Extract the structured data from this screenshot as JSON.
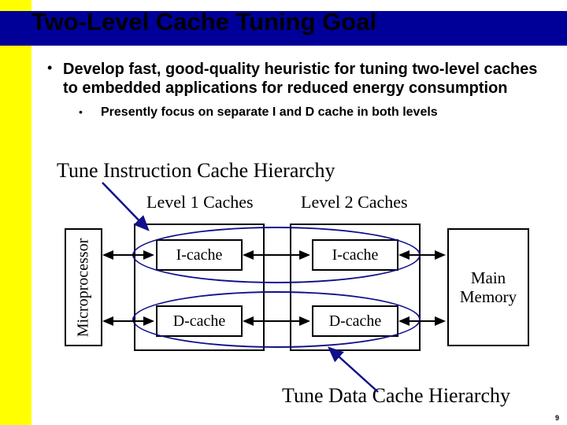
{
  "title": "Two-Level Cache Tuning Goal",
  "bullets": {
    "main": "Develop fast, good-quality heuristic for tuning two-level caches to embedded applications for reduced energy consumption",
    "sub": "Presently focus on separate I and D cache in both levels"
  },
  "annotations": {
    "tune_i": "Tune Instruction Cache Hierarchy",
    "tune_d": "Tune Data Cache Hierarchy"
  },
  "labels": {
    "l1": "Level 1 Caches",
    "l2": "Level 2 Caches"
  },
  "boxes": {
    "microprocessor": "Microprocessor",
    "icache": "I-cache",
    "dcache": "D-cache",
    "main_memory": "Main\nMemory"
  },
  "page_number": "9"
}
